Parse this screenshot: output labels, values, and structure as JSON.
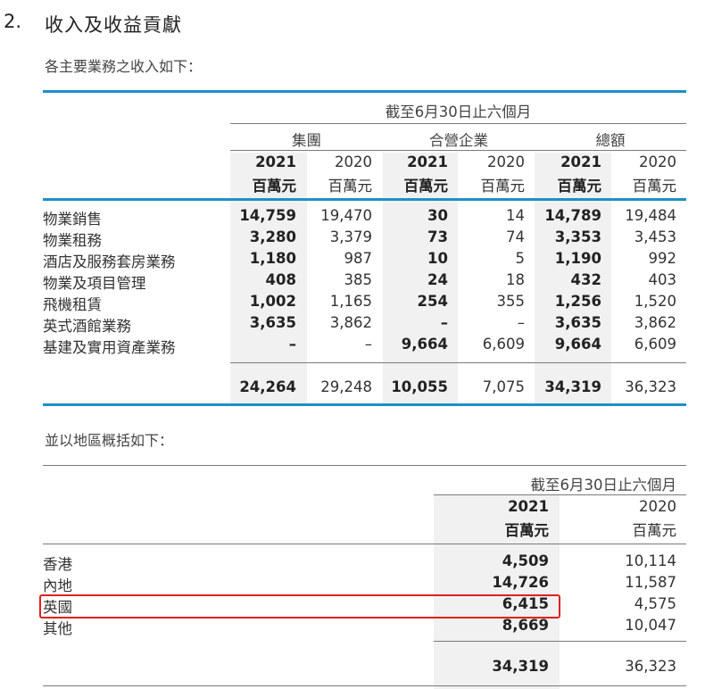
{
  "section": {
    "number": "2.",
    "title": "收入及收益貢獻"
  },
  "table1": {
    "intro": "各主要業務之收入如下：",
    "period": "截至6月30日止六個月",
    "groups": [
      "集團",
      "合營企業",
      "總額"
    ],
    "years": [
      "2021",
      "2020",
      "2021",
      "2020",
      "2021",
      "2020"
    ],
    "unit": "百萬元",
    "rows": [
      {
        "label": "物業銷售",
        "values": [
          "14,759",
          "19,470",
          "30",
          "14",
          "14,789",
          "19,484"
        ]
      },
      {
        "label": "物業租務",
        "values": [
          "3,280",
          "3,379",
          "73",
          "74",
          "3,353",
          "3,453"
        ]
      },
      {
        "label": "酒店及服務套房業務",
        "values": [
          "1,180",
          "987",
          "10",
          "5",
          "1,190",
          "992"
        ]
      },
      {
        "label": "物業及項目管理",
        "values": [
          "408",
          "385",
          "24",
          "18",
          "432",
          "403"
        ]
      },
      {
        "label": "飛機租賃",
        "values": [
          "1,002",
          "1,165",
          "254",
          "355",
          "1,256",
          "1,520"
        ]
      },
      {
        "label": "英式酒館業務",
        "values": [
          "3,635",
          "3,862",
          "–",
          "–",
          "3,635",
          "3,862"
        ]
      },
      {
        "label": "基建及實用資產業務",
        "values": [
          "–",
          "–",
          "9,664",
          "6,609",
          "9,664",
          "6,609"
        ]
      }
    ],
    "totals": [
      "24,264",
      "29,248",
      "10,055",
      "7,075",
      "34,319",
      "36,323"
    ]
  },
  "table2": {
    "intro": "並以地區概括如下：",
    "period": "截至6月30日止六個月",
    "years": [
      "2021",
      "2020"
    ],
    "unit": "百萬元",
    "rows": [
      {
        "label": "香港",
        "values": [
          "4,509",
          "10,114"
        ]
      },
      {
        "label": "內地",
        "values": [
          "14,726",
          "11,587"
        ]
      },
      {
        "label": "英國",
        "values": [
          "6,415",
          "4,575"
        ]
      },
      {
        "label": "其他",
        "values": [
          "8,669",
          "10,047"
        ]
      }
    ],
    "totals": [
      "34,319",
      "36,323"
    ]
  },
  "colors": {
    "accent_rule": "#1f8fc9",
    "highlight_box": "#e02020",
    "shade": "#f1f1f1"
  }
}
